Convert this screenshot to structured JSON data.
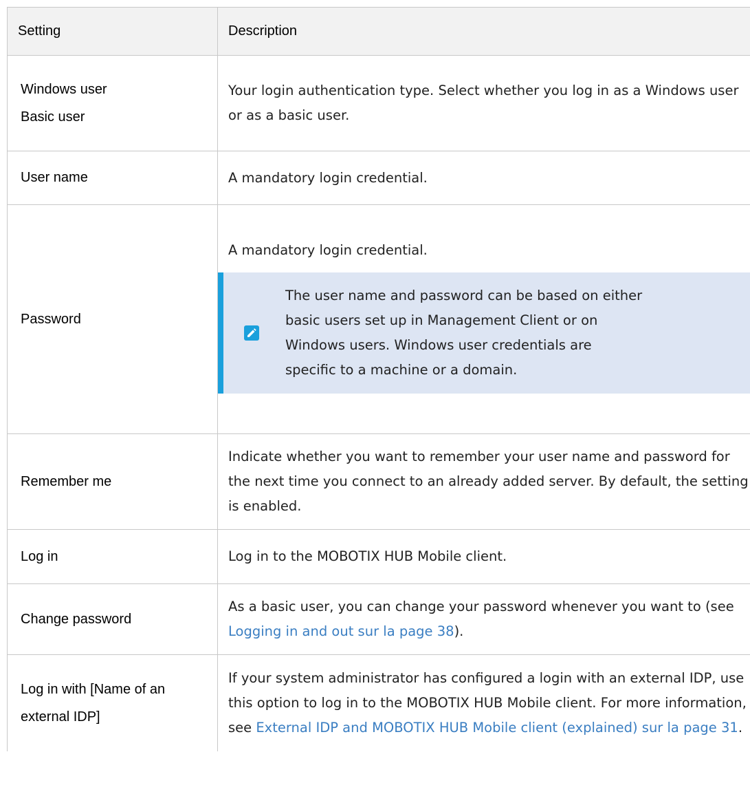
{
  "headers": {
    "setting": "Setting",
    "description": "Description"
  },
  "rows": {
    "auth": {
      "setting_lines": [
        "Windows user",
        "Basic user"
      ],
      "description": "Your login authentication type. Select whether you log in as a Windows user or as a basic user."
    },
    "username": {
      "setting": "User name",
      "description": "A mandatory login credential."
    },
    "password": {
      "setting": "Password",
      "description": "A mandatory login credential.",
      "note": "The user name and password can be based on either basic users set up in Management Client or on Windows users. Windows user credentials are specific to a machine or a domain.",
      "note_icon": "pencil-icon"
    },
    "remember": {
      "setting": "Remember me",
      "description": "Indicate whether you want to remember your user name and password for the next time you connect to an already added server. By default, the setting is enabled."
    },
    "login": {
      "setting": "Log in",
      "description": "Log in to the MOBOTIX HUB Mobile client."
    },
    "change_password": {
      "setting": "Change password",
      "description_before": "As a basic user, you can change your password whenever you want to (see ",
      "description_link": "Logging in and out sur la page 38",
      "description_after": ")."
    },
    "external_idp": {
      "setting": "Log in with [Name of an external IDP]",
      "description_before": "If your system administrator has configured a login with an external IDP, use this option to log in to the MOBOTIX HUB Mobile client. For more information, see ",
      "description_link": "External IDP and MOBOTIX HUB Mobile client (explained) sur la page 31",
      "description_after": "."
    }
  },
  "colors": {
    "link": "#3a7ec2",
    "note_bg": "#dde5f3",
    "note_accent": "#1aa0dc"
  }
}
